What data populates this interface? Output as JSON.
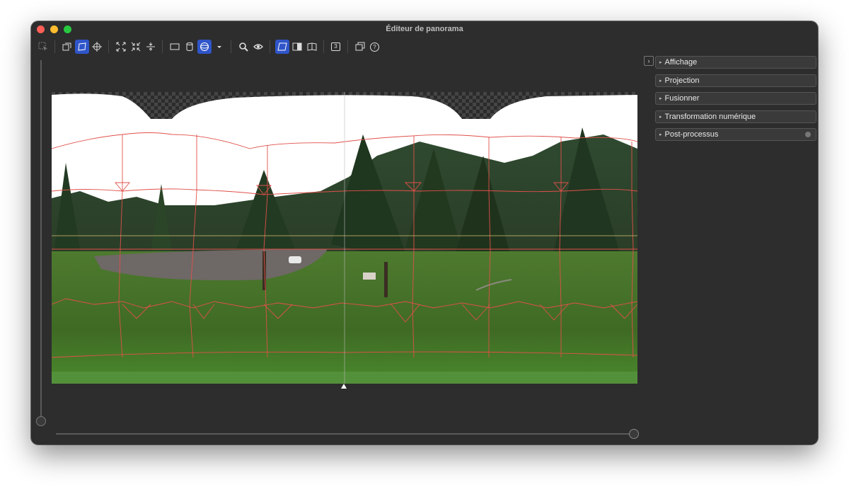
{
  "window": {
    "title": "Éditeur de panorama"
  },
  "toolbar": {
    "icons": [
      "select-icon",
      "overlay-icon",
      "adjust-icon",
      "crosshair-icon",
      "fit-icon",
      "shrink-icon",
      "straighten-icon",
      "rect-projection-icon",
      "cylinder-projection-icon",
      "sphere-projection-icon",
      "dropdown-icon",
      "zoom-icon",
      "eye-icon",
      "frame-icon",
      "split-icon",
      "book-icon",
      "three-icon",
      "window-icon",
      "help-icon"
    ],
    "three_label": "3",
    "help_label": "?"
  },
  "panel": {
    "collapse_label": "›",
    "items": [
      {
        "label": "Affichage"
      },
      {
        "label": "Projection"
      },
      {
        "label": "Fusionner"
      },
      {
        "label": "Transformation numérique"
      },
      {
        "label": "Post-processus"
      }
    ]
  },
  "colors": {
    "accent": "#2f55c9",
    "seam": "#e0504a",
    "background": "#2d2d2d"
  }
}
